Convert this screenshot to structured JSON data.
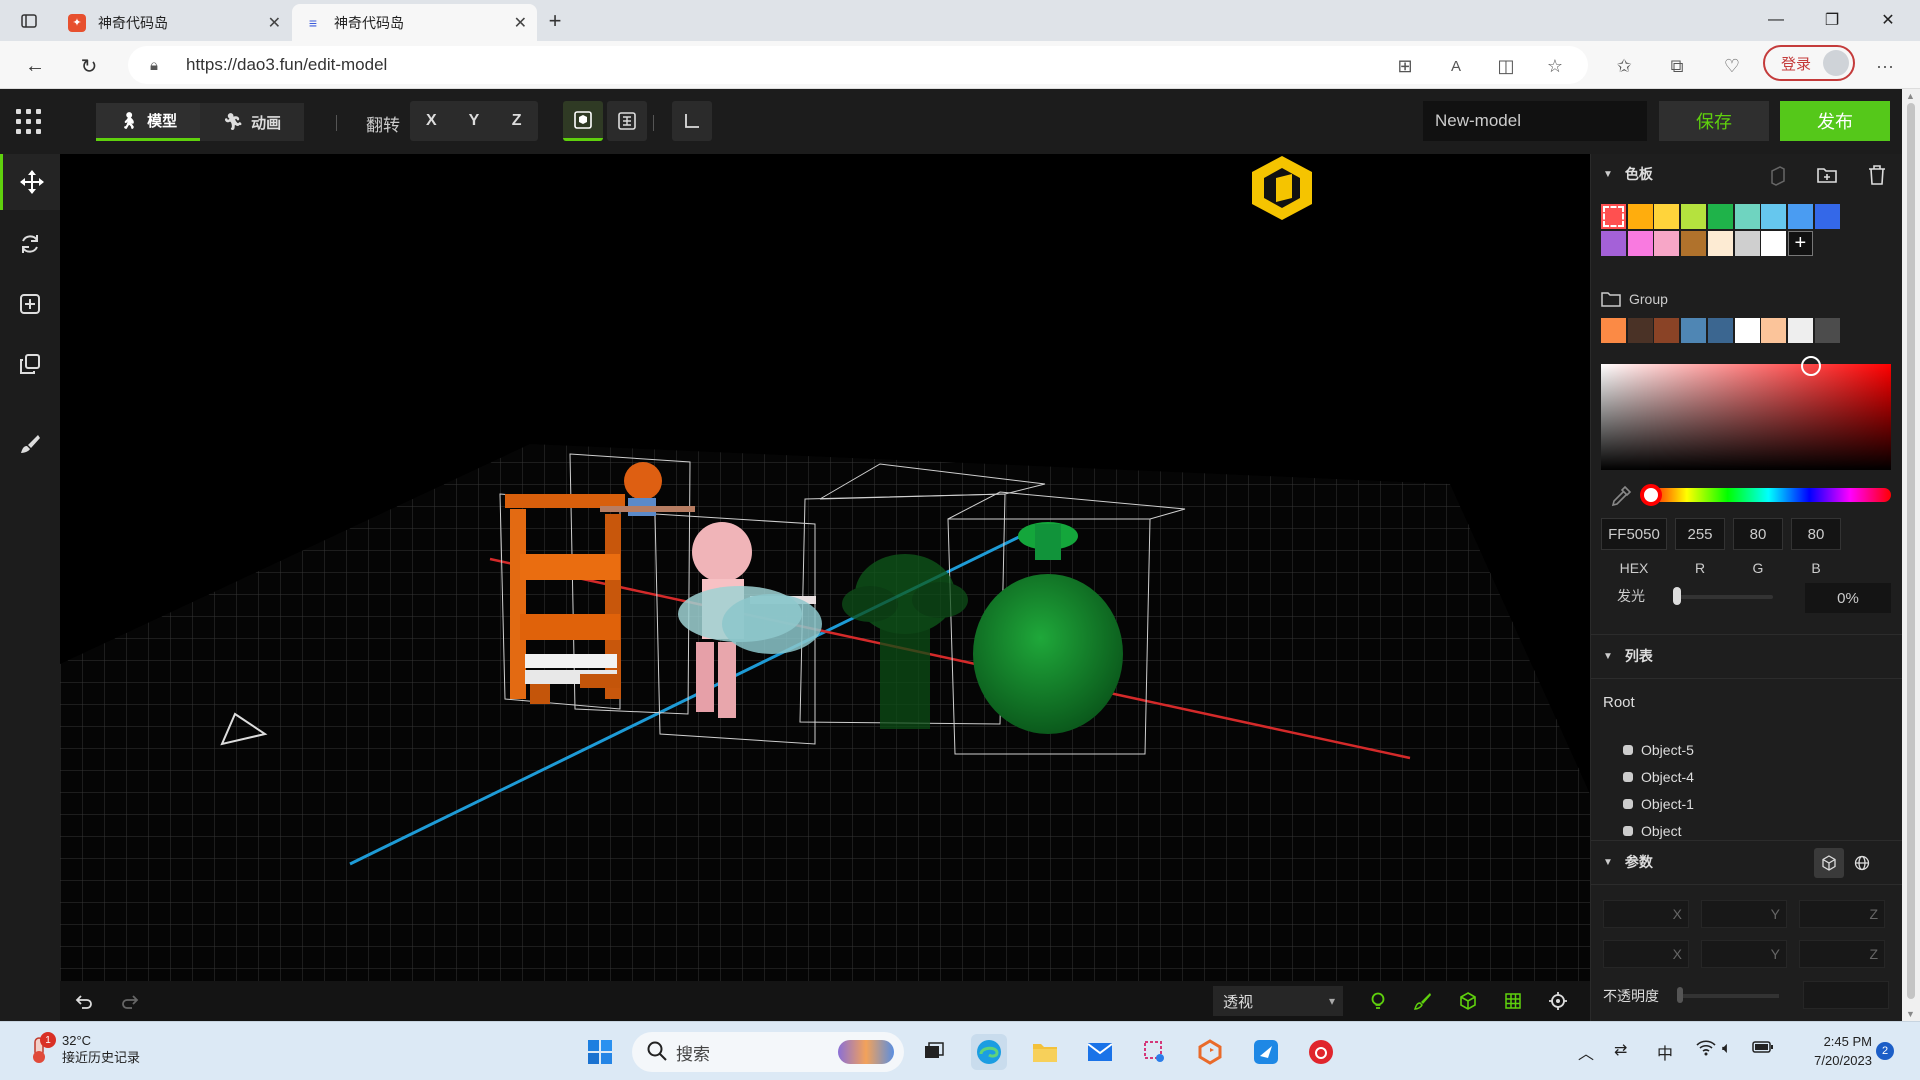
{
  "browser": {
    "tabs": [
      {
        "title": "神奇代码岛",
        "active": false
      },
      {
        "title": "神奇代码岛",
        "active": true
      }
    ],
    "url": "https://dao3.fun/edit-model",
    "login_label": "登录"
  },
  "toolbar": {
    "modes": [
      {
        "label": "模型",
        "icon": "person-icon",
        "active": true
      },
      {
        "label": "动画",
        "icon": "running-icon",
        "active": false
      }
    ],
    "flip_label": "翻转",
    "axes": [
      "X",
      "Y",
      "Z"
    ],
    "model_name": "New-model",
    "save_label": "保存",
    "publish_label": "发布",
    "accent_color": "#5fd10d"
  },
  "left_tools": [
    "move-icon",
    "rotate-icon",
    "add-icon",
    "copy-icon",
    "brush-icon"
  ],
  "viewport": {
    "view_mode": "透视",
    "bottom_icons": [
      "light-icon",
      "brush-icon",
      "cube-icon",
      "grid-icon",
      "target-icon"
    ]
  },
  "palette": {
    "title": "色板",
    "colors_row1": [
      "#ff5050",
      "#ffad0d",
      "#ffd43b",
      "#b5e23e",
      "#1fb34a",
      "#6fd4c0",
      "#66c7ee",
      "#4a9cf2",
      "#3468e8"
    ],
    "colors_row2": [
      "#a461d8",
      "#f97ae0",
      "#f7a6c7",
      "#b0722c",
      "#fdebd3",
      "#cfcfcf",
      "#ffffff"
    ],
    "selected_color": "#ff5050",
    "group_label": "Group",
    "group_colors": [
      "#fb8a45",
      "#4a3226",
      "#8a4326",
      "#4f86b4",
      "#3b6690",
      "#ffffff",
      "#fbc49a",
      "#eeeeee",
      "#4c4c4c"
    ],
    "hex": "FF5050",
    "r": "255",
    "g": "80",
    "b": "80",
    "labels": {
      "hex": "HEX",
      "r": "R",
      "g": "G",
      "b": "B"
    },
    "glow_label": "发光",
    "glow_value": "0%",
    "glow_level": 0
  },
  "list": {
    "title": "列表",
    "root": "Root",
    "items": [
      "Object-5",
      "Object-4",
      "Object-1",
      "Object"
    ]
  },
  "params": {
    "title": "参数",
    "axis_labels": [
      "X",
      "Y",
      "Z"
    ],
    "opacity_label": "不透明度"
  },
  "taskbar": {
    "weather_temp": "32°C",
    "weather_text": "接近历史记录",
    "weather_alert": "1",
    "search_label": "搜索",
    "ime": "中",
    "time": "2:45 PM",
    "date": "7/20/2023",
    "notifications": "2"
  }
}
